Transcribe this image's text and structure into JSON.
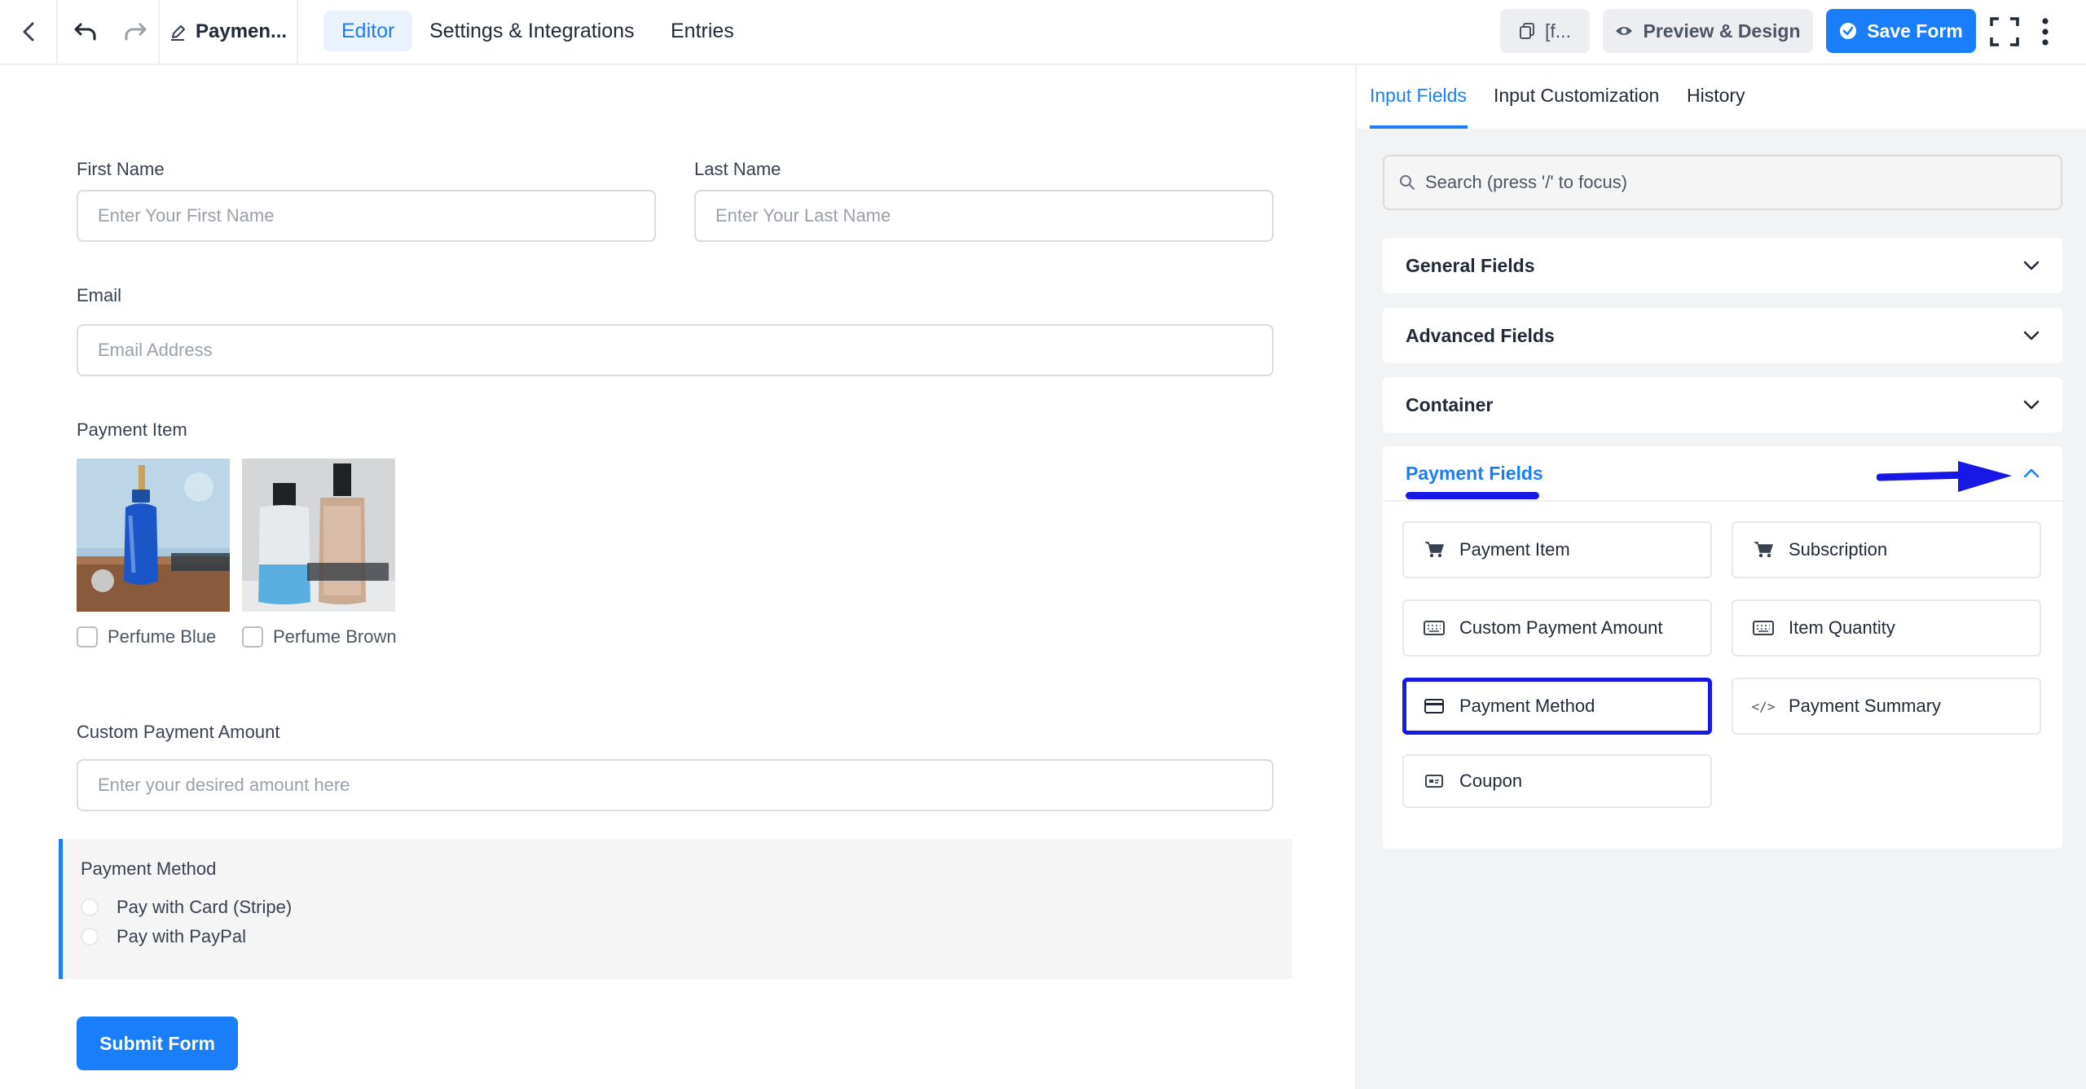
{
  "topbar": {
    "form_title": "Paymen...",
    "tabs": [
      {
        "label": "Editor",
        "active": true
      },
      {
        "label": "Settings & Integrations",
        "active": false
      },
      {
        "label": "Entries",
        "active": false
      }
    ],
    "shortcode_label": "[f...",
    "preview_label": "Preview & Design",
    "save_label": "Save Form"
  },
  "form": {
    "first_name": {
      "label": "First Name",
      "placeholder": "Enter Your First Name"
    },
    "last_name": {
      "label": "Last Name",
      "placeholder": "Enter Your Last Name"
    },
    "email": {
      "label": "Email",
      "placeholder": "Email Address"
    },
    "payment_item": {
      "label": "Payment Item",
      "options": [
        {
          "label": "Perfume Blue",
          "checked": false
        },
        {
          "label": "Perfume Brown",
          "checked": false
        }
      ]
    },
    "custom_amount": {
      "label": "Custom Payment Amount",
      "placeholder": "Enter your desired amount here"
    },
    "payment_method": {
      "label": "Payment Method",
      "options": [
        "Pay with Card (Stripe)",
        "Pay with PayPal"
      ]
    },
    "submit_label": "Submit Form"
  },
  "panel": {
    "tabs": [
      {
        "label": "Input Fields",
        "active": true
      },
      {
        "label": "Input Customization",
        "active": false
      },
      {
        "label": "History",
        "active": false
      }
    ],
    "search_placeholder": "Search (press '/' to focus)",
    "sections": [
      "General Fields",
      "Advanced Fields",
      "Container"
    ],
    "payment_fields": {
      "title": "Payment Fields",
      "items": [
        {
          "label": "Payment Item",
          "icon": "cart-icon"
        },
        {
          "label": "Subscription",
          "icon": "cart-icon"
        },
        {
          "label": "Custom Payment Amount",
          "icon": "keyboard-icon"
        },
        {
          "label": "Item Quantity",
          "icon": "keyboard-icon"
        },
        {
          "label": "Payment Method",
          "icon": "credit-card-icon",
          "highlighted": true
        },
        {
          "label": "Payment Summary",
          "icon": "code-icon"
        },
        {
          "label": "Coupon",
          "icon": "coupon-icon"
        }
      ]
    }
  },
  "colors": {
    "accent": "#1a7efb",
    "annotation": "#1717e6"
  }
}
